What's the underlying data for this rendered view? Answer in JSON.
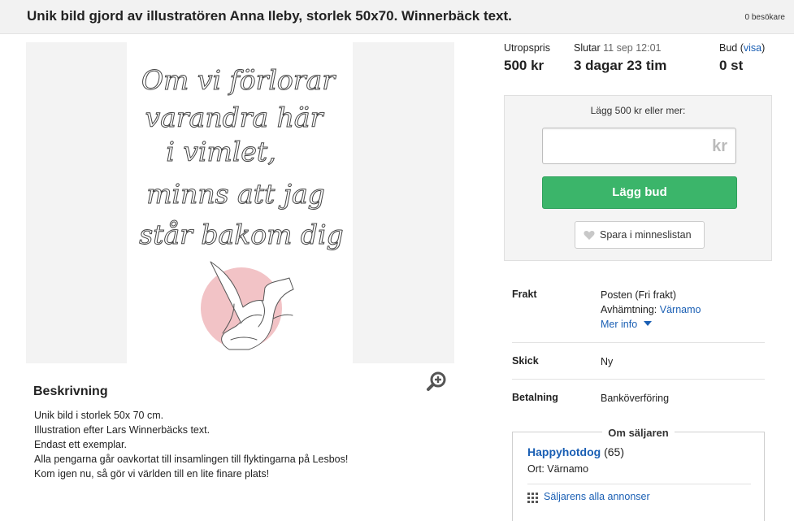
{
  "header": {
    "title": "Unik bild gjord av illustratören Anna Ileby, storlek 50x70. Winnerbäck text.",
    "visitors": "0 besökare"
  },
  "image": {
    "poster_lines": [
      "Om vi förlorar",
      "varandra här",
      "i vimlet,",
      "minns att jag",
      "står bakom dig"
    ],
    "accent_color": "#f2c3c6"
  },
  "description": {
    "heading": "Beskrivning",
    "lines": [
      "Unik bild i storlek 50x 70 cm.",
      "Illustration efter Lars Winnerbäcks text.",
      "Endast ett exemplar.",
      "Alla pengarna går oavkortat till insamlingen till flyktingarna på Lesbos!",
      "Kom igen nu, så gör vi världen till en lite finare plats!"
    ]
  },
  "stats": {
    "reserve": {
      "label": "Utropspris",
      "value": "500 kr"
    },
    "ends": {
      "label": "Slutar",
      "date": "11 sep 12:01",
      "value": "3 dagar 23 tim"
    },
    "bids": {
      "label": "Bud",
      "open_paren": "(",
      "link": "visa",
      "close_paren": ")",
      "value": "0 st"
    }
  },
  "bid": {
    "prompt": "Lägg 500 kr eller mer:",
    "input_value": "",
    "unit": "kr",
    "button_label": "Lägg bud",
    "save_label": "Spara i minneslistan",
    "button_color": "#3bb56a"
  },
  "details": {
    "shipping": {
      "label": "Frakt",
      "line1": "Posten (Fri frakt)",
      "pickup_label": "Avhämtning:",
      "pickup_city": "Värnamo",
      "more_info": "Mer info"
    },
    "condition": {
      "label": "Skick",
      "value": "Ny"
    },
    "payment": {
      "label": "Betalning",
      "value": "Banköverföring"
    }
  },
  "seller": {
    "heading": "Om säljaren",
    "name": "Happyhotdog",
    "rating": "(65)",
    "city": "Ort: Värnamo",
    "all_ads": "Säljarens alla annonser"
  },
  "icons": {
    "zoom": "zoom-in-icon",
    "heart": "heart-icon",
    "chevron": "caret-down-icon",
    "grid": "grid-icon"
  }
}
